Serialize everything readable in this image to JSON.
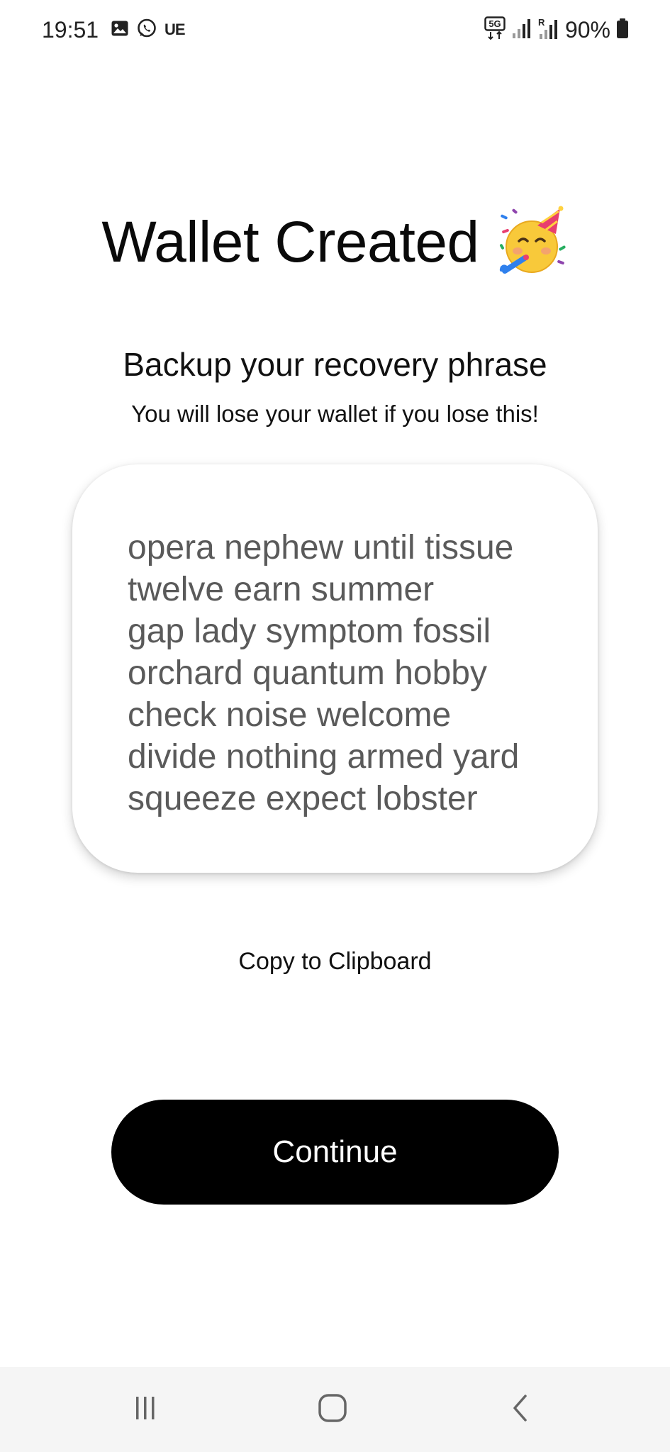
{
  "status_bar": {
    "time": "19:51",
    "carrier": "UE",
    "battery": "90%",
    "icons_left": [
      "gallery-icon",
      "whatsapp-icon"
    ],
    "icons_right": [
      "5g-icon",
      "signal-icon",
      "signal-roaming-icon",
      "battery-icon"
    ]
  },
  "header": {
    "title": "Wallet Created",
    "emoji": "partying-face-icon"
  },
  "subtitle": "Backup your recovery phrase",
  "warning": "You will lose your wallet if you lose this!",
  "phrase": {
    "lines": [
      "opera nephew until tissue",
      "twelve earn summer",
      "gap lady symptom fossil",
      "orchard quantum hobby",
      "check noise welcome",
      "divide nothing armed yard",
      "squeeze expect lobster"
    ]
  },
  "actions": {
    "copy_label": "Copy to Clipboard",
    "continue_label": "Continue"
  },
  "nav_bar": {
    "buttons": [
      "recents-icon",
      "home-icon",
      "back-icon"
    ]
  },
  "colors": {
    "background": "#ffffff",
    "button_bg": "#000000",
    "button_text": "#ffffff",
    "phrase_text": "#5a5a5a",
    "nav_bar_bg": "#f5f5f5"
  }
}
